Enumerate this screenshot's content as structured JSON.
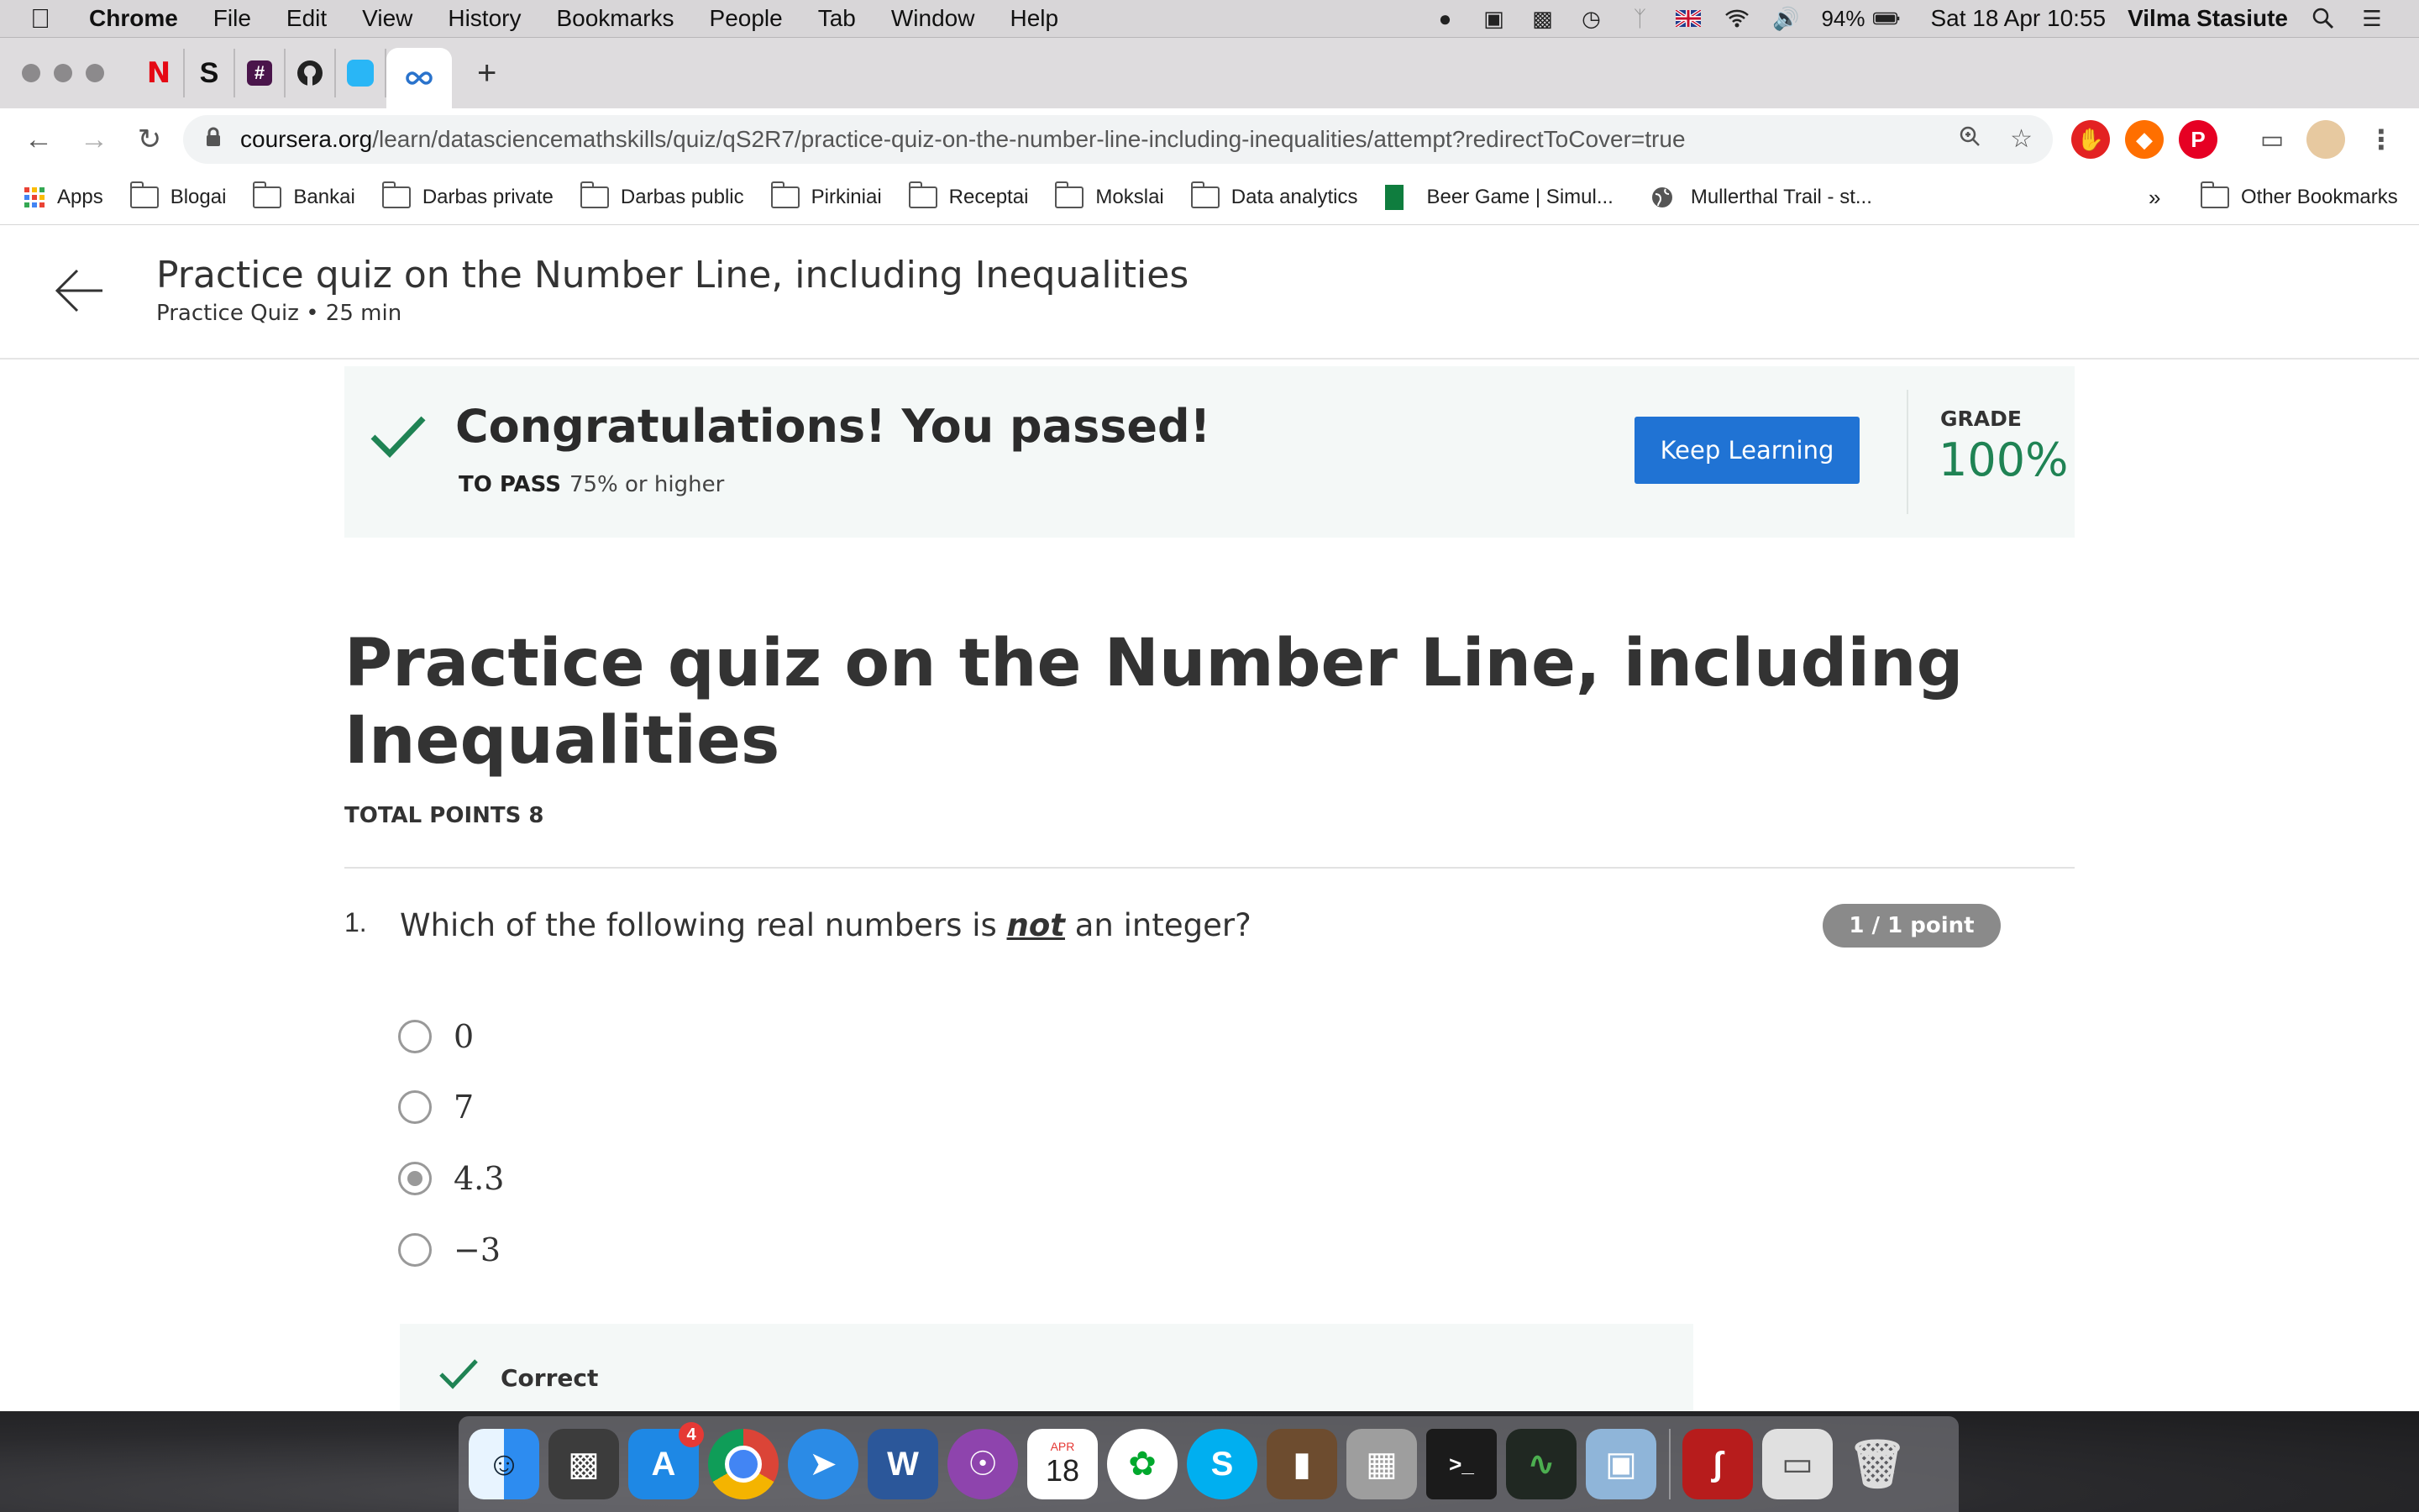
{
  "menubar": {
    "app": "Chrome",
    "items": [
      "File",
      "Edit",
      "View",
      "History",
      "Bookmarks",
      "People",
      "Tab",
      "Window",
      "Help"
    ],
    "battery": "94%",
    "datetime": "Sat 18 Apr  10:55",
    "user": "Vilma Stasiute"
  },
  "browser": {
    "url_domain": "coursera.org",
    "url_path": "/learn/datasciencemathskills/quiz/qS2R7/practice-quiz-on-the-number-line-including-inequalities/attempt?redirectToCover=true",
    "bookmarks": [
      {
        "label": "Apps",
        "icon": "apps-grid-icon"
      },
      {
        "label": "Blogai",
        "icon": "folder-icon"
      },
      {
        "label": "Bankai",
        "icon": "folder-icon"
      },
      {
        "label": "Darbas private",
        "icon": "folder-icon"
      },
      {
        "label": "Darbas public",
        "icon": "folder-icon"
      },
      {
        "label": "Pirkiniai",
        "icon": "folder-icon"
      },
      {
        "label": "Receptai",
        "icon": "folder-icon"
      },
      {
        "label": "Mokslai",
        "icon": "folder-icon"
      },
      {
        "label": "Data analytics",
        "icon": "folder-icon"
      },
      {
        "label": "Beer Game | Simul...",
        "icon": "green-square-icon"
      },
      {
        "label": "Mullerthal Trail - st...",
        "icon": "globe-icon"
      }
    ],
    "overflow": "»",
    "other_bookmarks": "Other Bookmarks"
  },
  "header": {
    "title": "Practice quiz on the Number Line, including Inequalities",
    "subtitle": "Practice Quiz • 25 min"
  },
  "result": {
    "title": "Congratulations! You passed!",
    "to_pass_label": "TO PASS",
    "to_pass_value": "75% or higher",
    "button": "Keep Learning",
    "grade_label": "GRADE",
    "grade_value": "100%"
  },
  "quiz": {
    "title": "Practice quiz on the Number Line, including Inequalities",
    "total_points": "TOTAL POINTS 8"
  },
  "question": {
    "number": "1.",
    "text_before": "Which of the following real numbers is ",
    "text_emph": "not",
    "text_after": " an integer?",
    "points": "1 / 1 point",
    "options": [
      "0",
      "7",
      "4.3",
      "−3"
    ],
    "selected_index": 2,
    "feedback": "Correct"
  },
  "dock": {
    "app_store_badge": "4",
    "calendar_month": "APR",
    "calendar_day": "18"
  },
  "colors": {
    "accent": "#2073d4",
    "success": "#1f8354",
    "pass_bg": "#f4f8f7",
    "badge": "#8a8a8a"
  }
}
